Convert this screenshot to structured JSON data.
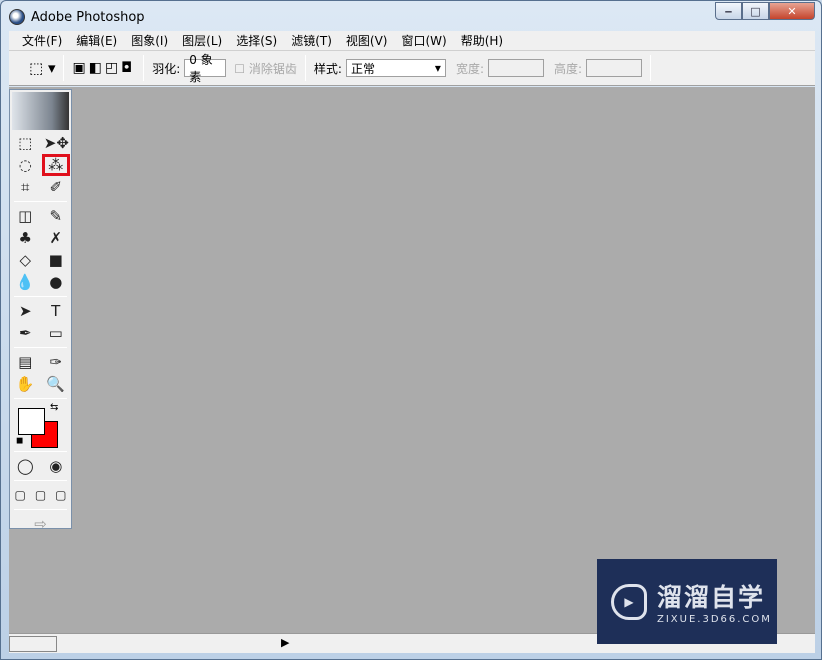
{
  "window": {
    "title": "Adobe Photoshop",
    "minimize": "‒",
    "maximize": "□",
    "close": "✕"
  },
  "menu": [
    "文件(F)",
    "编辑(E)",
    "图象(I)",
    "图层(L)",
    "选择(S)",
    "滤镜(T)",
    "视图(V)",
    "窗口(W)",
    "帮助(H)"
  ],
  "options": {
    "feather_label": "羽化:",
    "feather_value": "0 象素",
    "antialias_label": "消除锯齿",
    "style_label": "样式:",
    "style_value": "正常",
    "width_label": "宽度:",
    "height_label": "高度:"
  },
  "tools": [
    [
      "⬚",
      "➤✥"
    ],
    [
      "◌",
      "⁂"
    ],
    [
      "⌗",
      "✐"
    ],
    [
      "◫",
      "✎"
    ],
    [
      "♣",
      "✗"
    ],
    [
      "◇",
      "■"
    ],
    [
      "💧",
      "●"
    ],
    [
      "➤",
      "T"
    ],
    [
      "✒",
      "▭"
    ],
    [
      "▤",
      "✑"
    ],
    [
      "✋",
      "🔍"
    ]
  ],
  "tool_names": [
    [
      "rectangular-marquee",
      "move"
    ],
    [
      "lasso",
      "magic-wand"
    ],
    [
      "crop",
      "slice"
    ],
    [
      "healing-brush",
      "brush"
    ],
    [
      "clone-stamp",
      "history-brush"
    ],
    [
      "eraser",
      "gradient"
    ],
    [
      "blur",
      "dodge"
    ],
    [
      "path-selection",
      "type"
    ],
    [
      "pen",
      "shape"
    ],
    [
      "notes",
      "eyedropper"
    ],
    [
      "hand",
      "zoom"
    ]
  ],
  "colors": {
    "foreground": "#ffffff",
    "background": "#ff0000",
    "highlight": "#e0101c"
  },
  "selected_tool": "magic-wand",
  "watermark": {
    "title": "溜溜自学",
    "url": "ZIXUE.3D66.COM"
  }
}
